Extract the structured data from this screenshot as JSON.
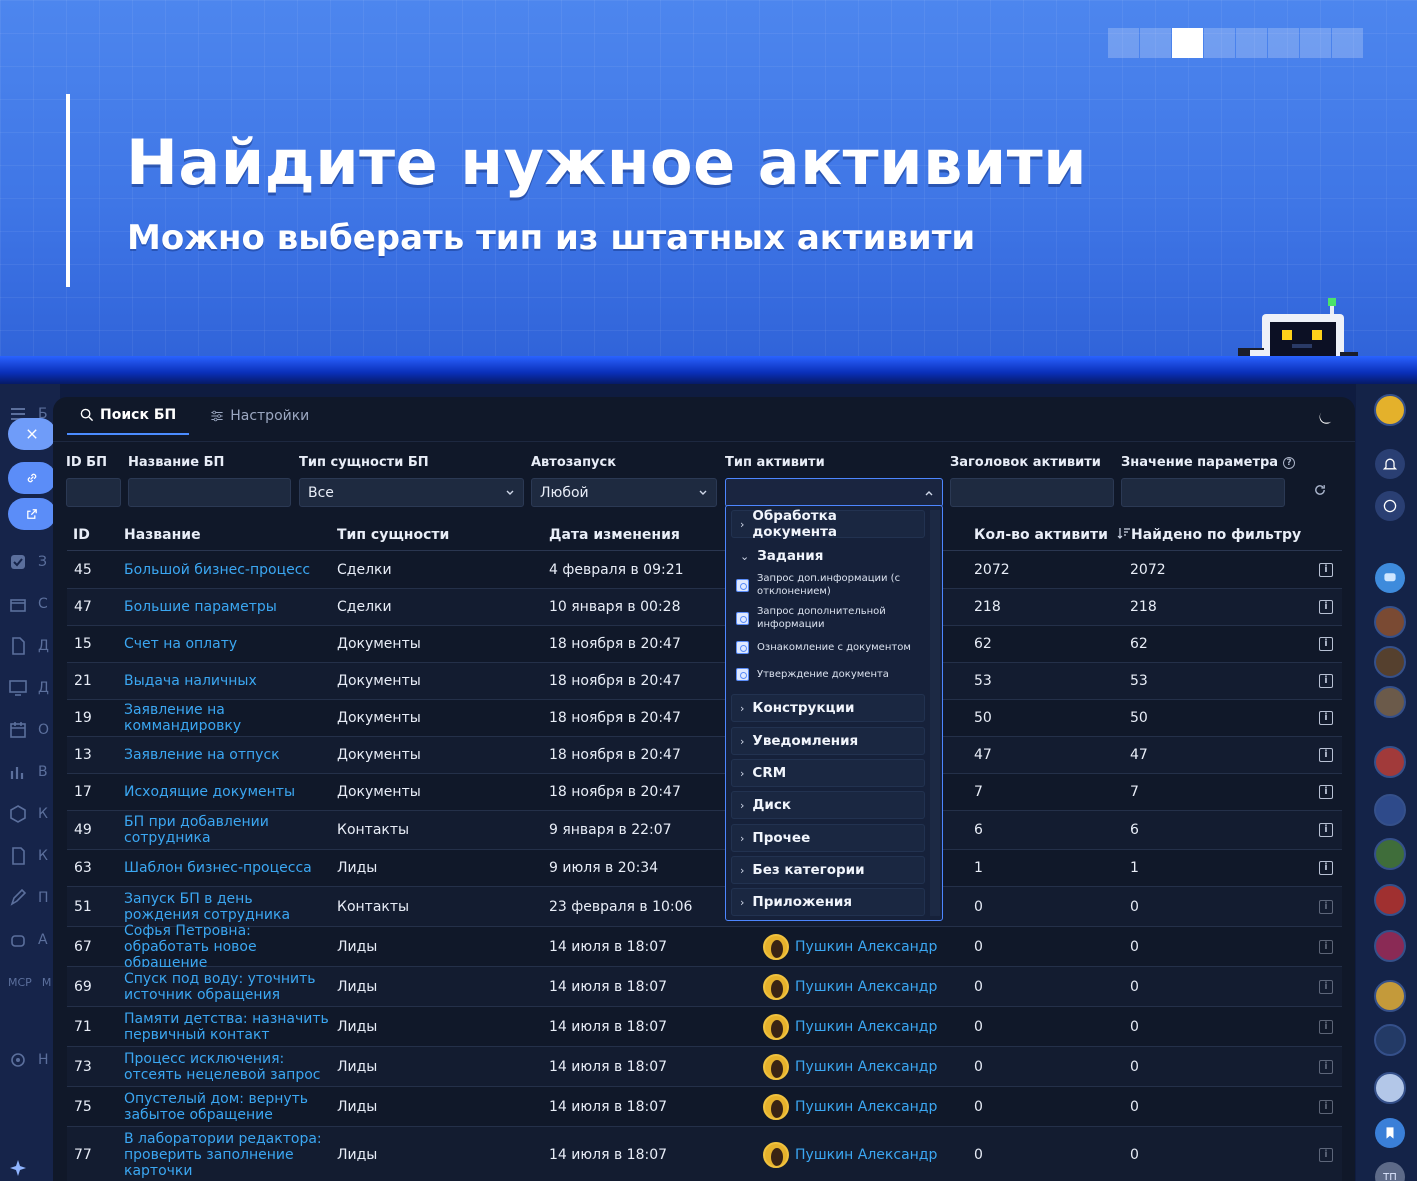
{
  "banner": {
    "headline": "Найдите нужное активити",
    "subline": "Можно выберать тип из штатных активити",
    "slide_count": 8,
    "active_slide": 3
  },
  "app": {
    "tabs": [
      {
        "label": "Поиск БП",
        "active": true,
        "icon": "search-icon"
      },
      {
        "label": "Настройки",
        "active": false,
        "icon": "sliders-icon"
      }
    ],
    "theme_icon": "moon-icon"
  },
  "left_rail": {
    "letters": [
      "Б",
      "З",
      "С",
      "Д",
      "Д",
      "О",
      "В",
      "К",
      "К",
      "П",
      "А",
      "М",
      "Н"
    ],
    "mcp": "MCP"
  },
  "filters": {
    "id": {
      "label": "ID БП",
      "value": ""
    },
    "name": {
      "label": "Название БП",
      "value": ""
    },
    "entity": {
      "label": "Тип сущности БП",
      "value": "Все"
    },
    "autorun": {
      "label": "Автозапуск",
      "value": "Любой"
    },
    "activity_type": {
      "label": "Тип активити",
      "value": ""
    },
    "activity_title": {
      "label": "Заголовок активити",
      "value": ""
    },
    "param_value": {
      "label": "Значение параметра",
      "value": ""
    }
  },
  "table": {
    "columns": {
      "id": "ID",
      "name": "Название",
      "entity": "Тип сущности",
      "changed": "Дата изменения",
      "activities": "Кол-во активити",
      "found": "Найдено по фильтру"
    },
    "rows": [
      {
        "id": "45",
        "name": "Большой бизнес-процесс",
        "entity": "Сделки",
        "changed": "4 февраля в 09:21",
        "owner": "",
        "activities": "2072",
        "found": "2072"
      },
      {
        "id": "47",
        "name": "Большие параметры",
        "entity": "Сделки",
        "changed": "10 января в 00:28",
        "owner": "",
        "activities": "218",
        "found": "218"
      },
      {
        "id": "15",
        "name": "Счет на оплату",
        "entity": "Документы",
        "changed": "18 ноября в 20:47",
        "owner": "",
        "activities": "62",
        "found": "62"
      },
      {
        "id": "21",
        "name": "Выдача наличных",
        "entity": "Документы",
        "changed": "18 ноября в 20:47",
        "owner": "",
        "activities": "53",
        "found": "53"
      },
      {
        "id": "19",
        "name": "Заявление на коммандировку",
        "entity": "Документы",
        "changed": "18 ноября в 20:47",
        "owner": "",
        "activities": "50",
        "found": "50"
      },
      {
        "id": "13",
        "name": "Заявление на отпуск",
        "entity": "Документы",
        "changed": "18 ноября в 20:47",
        "owner": "",
        "activities": "47",
        "found": "47"
      },
      {
        "id": "17",
        "name": "Исходящие документы",
        "entity": "Документы",
        "changed": "18 ноября в 20:47",
        "owner": "",
        "activities": "7",
        "found": "7"
      },
      {
        "id": "49",
        "name": "БП при добавлении сотрудника",
        "entity": "Контакты",
        "changed": "9 января в 22:07",
        "owner": "",
        "activities": "6",
        "found": "6"
      },
      {
        "id": "63",
        "name": "Шаблон бизнес-процесса",
        "entity": "Лиды",
        "changed": "9 июля в 20:34",
        "owner": "",
        "activities": "1",
        "found": "1"
      },
      {
        "id": "51",
        "name": "Запуск БП в день рождения сотрудника",
        "entity": "Контакты",
        "changed": "23 февраля в 10:06",
        "owner": "",
        "activities": "0",
        "found": "0"
      },
      {
        "id": "67",
        "name": "Софья Петровна: обработать новое обращение",
        "entity": "Лиды",
        "changed": "14 июля в 18:07",
        "owner": "Пушкин Александр",
        "activities": "0",
        "found": "0"
      },
      {
        "id": "69",
        "name": "Спуск под воду: уточнить источник обращения",
        "entity": "Лиды",
        "changed": "14 июля в 18:07",
        "owner": "Пушкин Александр",
        "activities": "0",
        "found": "0"
      },
      {
        "id": "71",
        "name": "Памяти детства: назначить первичный контакт",
        "entity": "Лиды",
        "changed": "14 июля в 18:07",
        "owner": "Пушкин Александр",
        "activities": "0",
        "found": "0"
      },
      {
        "id": "73",
        "name": "Процесс исключения: отсеять нецелевой запрос",
        "entity": "Лиды",
        "changed": "14 июля в 18:07",
        "owner": "Пушкин Александр",
        "activities": "0",
        "found": "0"
      },
      {
        "id": "75",
        "name": "Опустелый дом: вернуть забытое обращение",
        "entity": "Лиды",
        "changed": "14 июля в 18:07",
        "owner": "Пушкин Александр",
        "activities": "0",
        "found": "0"
      },
      {
        "id": "77",
        "name": "В лаборатории редактора: проверить заполнение карточки",
        "entity": "Лиды",
        "changed": "14 июля в 18:07",
        "owner": "Пушкин Александр",
        "activities": "0",
        "found": "0"
      }
    ]
  },
  "dropdown": {
    "categories": [
      {
        "label": "Обработка документа",
        "expanded": false
      },
      {
        "label": "Задания",
        "expanded": true,
        "items": [
          "Запрос доп.информации (с отклонением)",
          "Запрос дополнительной информации",
          "Ознакомление с документом",
          "Утверждение документа"
        ]
      },
      {
        "label": "Конструкции",
        "expanded": false
      },
      {
        "label": "Уведомления",
        "expanded": false
      },
      {
        "label": "CRM",
        "expanded": false
      },
      {
        "label": "Диск",
        "expanded": false
      },
      {
        "label": "Прочее",
        "expanded": false
      },
      {
        "label": "Без категории",
        "expanded": false
      },
      {
        "label": "Приложения",
        "expanded": false
      }
    ]
  },
  "right_rail": {
    "icons": [
      "bell-icon",
      "chat-search-icon",
      "chat-bubble-icon",
      "bookmark-icon"
    ],
    "partial_avatar_text": "ТП"
  }
}
